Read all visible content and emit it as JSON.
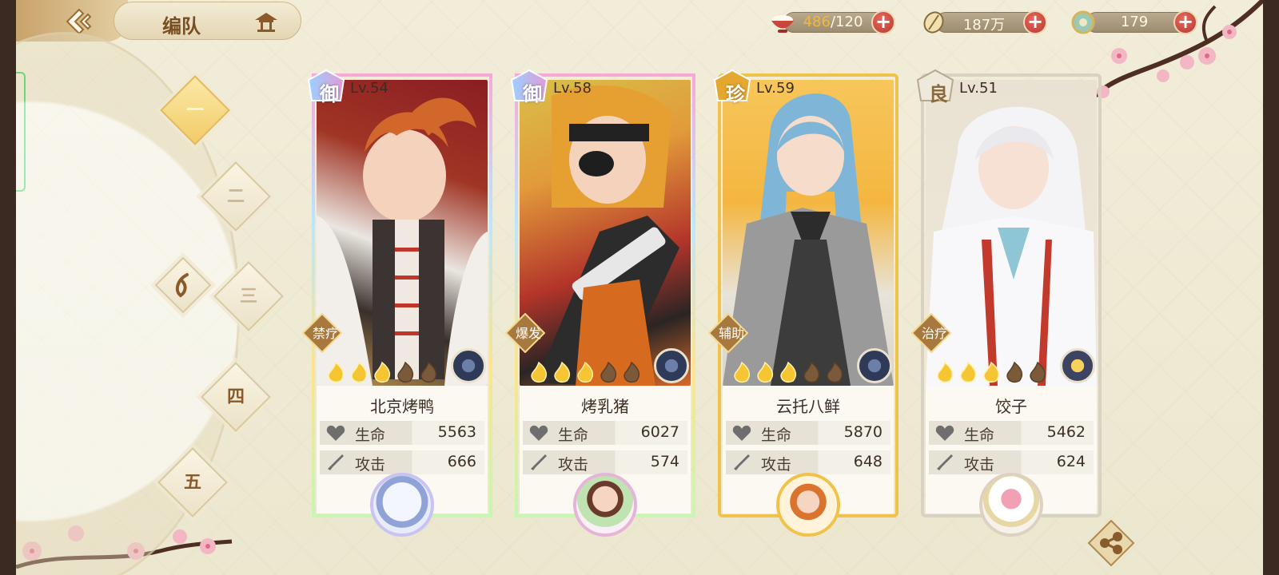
{
  "header": {
    "title": "编队"
  },
  "resources": [
    {
      "name": "stamina",
      "current": "486",
      "max": "/120",
      "icon": "rice-bowl-icon"
    },
    {
      "name": "gold",
      "value": "187万",
      "icon": "coin-scroll-icon"
    },
    {
      "name": "gem",
      "value": "179",
      "icon": "jade-icon"
    }
  ],
  "teams": [
    {
      "label": "一",
      "active": true
    },
    {
      "label": "二",
      "active": false
    },
    {
      "label": "三",
      "active": false
    },
    {
      "label": "四",
      "active": false
    },
    {
      "label": "五",
      "active": false
    }
  ],
  "cards": [
    {
      "rarity": "御",
      "level": "Lv.54",
      "role": "禁疗",
      "name": "北京烤鸭",
      "stars": 3,
      "max_stars": 5,
      "hp_label": "生命",
      "hp": "5563",
      "atk_label": "攻击",
      "atk": "666",
      "element": "dark-flower-icon"
    },
    {
      "rarity": "御",
      "level": "Lv.58",
      "role": "爆发",
      "name": "烤乳猪",
      "stars": 3,
      "max_stars": 5,
      "hp_label": "生命",
      "hp": "6027",
      "atk_label": "攻击",
      "atk": "574",
      "element": "dark-flower-icon"
    },
    {
      "rarity": "珍",
      "level": "Lv.59",
      "role": "辅助",
      "name": "云托八鲜",
      "stars": 3,
      "max_stars": 5,
      "hp_label": "生命",
      "hp": "5870",
      "atk_label": "攻击",
      "atk": "648",
      "element": "dark-flower-icon"
    },
    {
      "rarity": "良",
      "level": "Lv.51",
      "role": "治疗",
      "name": "饺子",
      "stars": 3,
      "max_stars": 5,
      "hp_label": "生命",
      "hp": "5462",
      "atk_label": "攻击",
      "atk": "624",
      "element": "gold-flower-icon"
    }
  ],
  "colors": {
    "accent_gold": "#f2cc6a",
    "brown_text": "#7a4e22",
    "plus_red": "#c9463a"
  }
}
